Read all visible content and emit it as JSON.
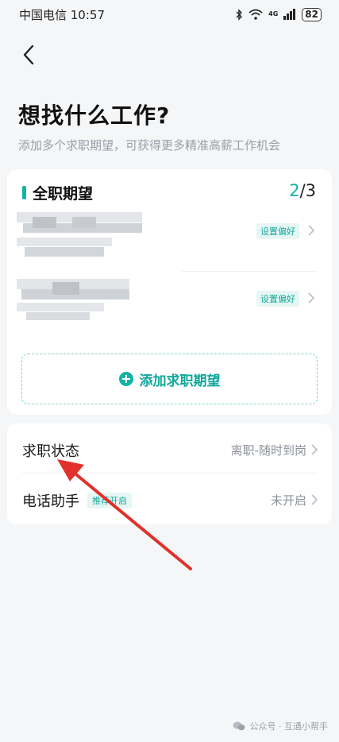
{
  "status_bar": {
    "carrier_time": "中国电信 10:57",
    "network": "4G",
    "battery": "82"
  },
  "header": {
    "back_icon": "chevron-left-icon",
    "title": "想找什么工作?",
    "subtitle": "添加多个求职期望，可获得更多精准高薪工作机会"
  },
  "expectations": {
    "title": "全职期望",
    "count_current": "2",
    "count_total": "/3",
    "items": [
      {
        "pref_label": "设置偏好"
      },
      {
        "pref_label": "设置偏好"
      }
    ],
    "add_label": "添加求职期望"
  },
  "settings": {
    "status": {
      "label": "求职状态",
      "value": "离职-随时到岗"
    },
    "phone_assistant": {
      "label": "电话助手",
      "tag": "推荐开启",
      "value": "未开启"
    }
  },
  "watermark": {
    "text": "公众号 · 互通小帮手"
  },
  "colors": {
    "accent": "#14b3a6",
    "arrow": "#e0312a",
    "background": "#f5f6f8"
  }
}
